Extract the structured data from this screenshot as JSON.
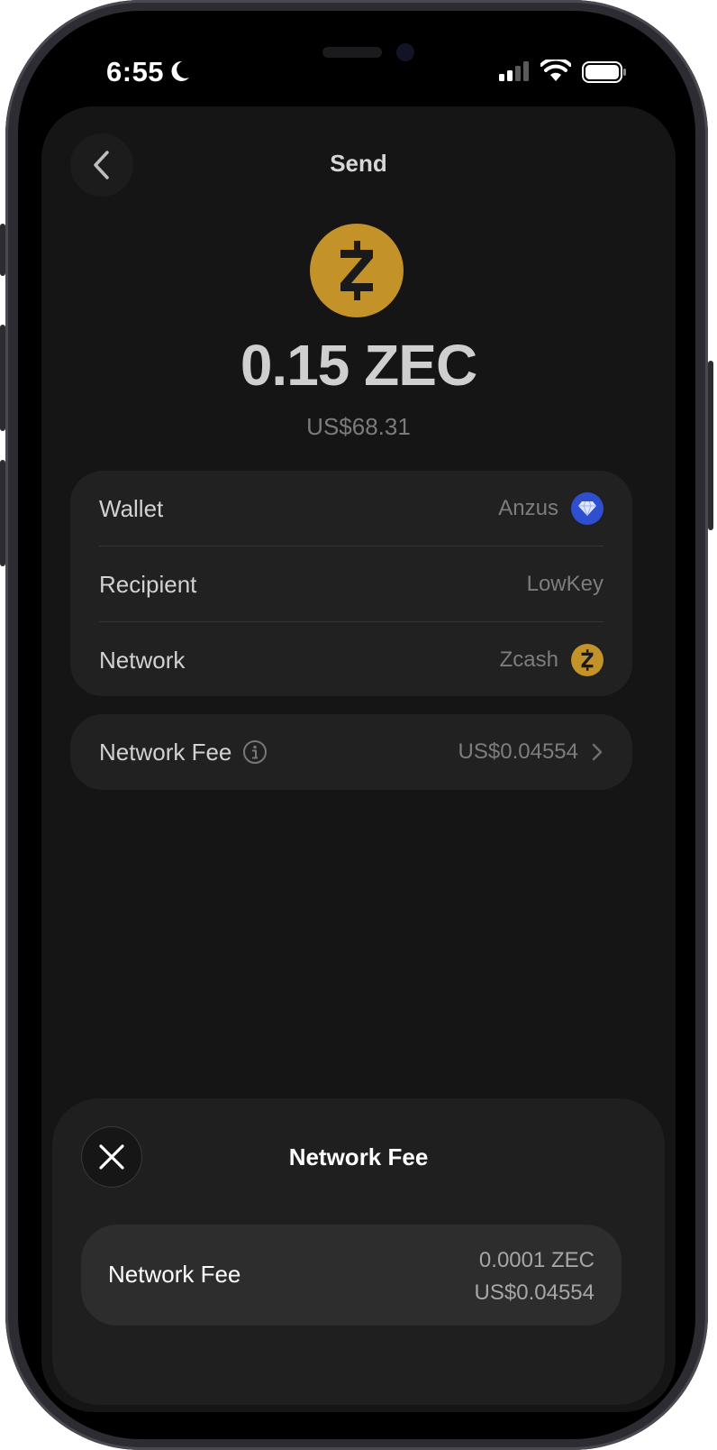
{
  "status_bar": {
    "time": "6:55"
  },
  "header": {
    "title": "Send"
  },
  "transaction": {
    "amount": "0.15 ZEC",
    "fiat_value": "US$68.31"
  },
  "details": {
    "wallet_label": "Wallet",
    "wallet_value": "Anzus",
    "recipient_label": "Recipient",
    "recipient_value": "LowKey",
    "network_label": "Network",
    "network_value": "Zcash"
  },
  "fee_row": {
    "label": "Network Fee",
    "value": "US$0.04554"
  },
  "sheet": {
    "title": "Network Fee",
    "fee_label": "Network Fee",
    "fee_crypto": "0.0001 ZEC",
    "fee_fiat": "US$0.04554"
  },
  "colors": {
    "zcash": "#c3932a",
    "wallet_icon": "#2f4fd1",
    "background": "#151515"
  },
  "icons": [
    "moon-icon",
    "signal-icon",
    "wifi-icon",
    "battery-icon",
    "chevron-left-icon",
    "zcash-coin-icon",
    "diamond-icon",
    "info-icon",
    "chevron-right-icon",
    "close-icon"
  ]
}
